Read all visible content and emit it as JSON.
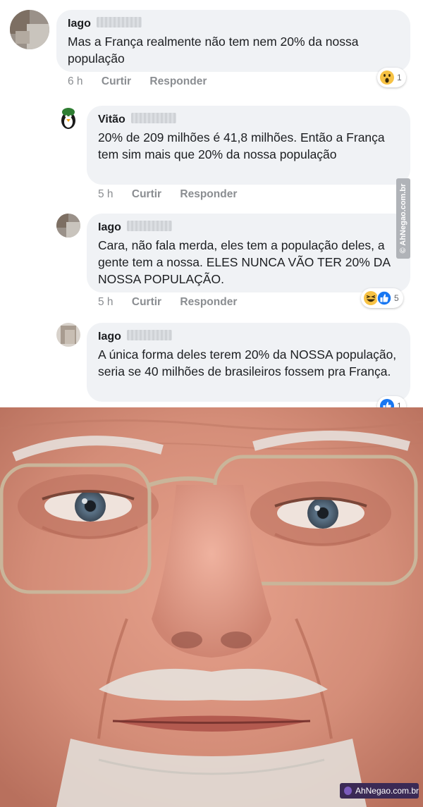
{
  "comments": [
    {
      "author": "Iago",
      "text": "Mas a França realmente não tem nem 20% da nossa população",
      "time": "6 h",
      "like": "Curtir",
      "reply": "Responder",
      "reaction_count": "1",
      "reaction_icons": [
        "wow-icon"
      ]
    },
    {
      "author": "Vitão",
      "text": "20% de 209 milhões é 41,8 milhões. Então a França tem sim mais que 20% da nossa população",
      "time": "5 h",
      "like": "Curtir",
      "reply": "Responder"
    },
    {
      "author": "Iago",
      "text": "Cara, não fala merda, eles tem a população deles, a gente tem a nossa. ELES NUNCA VÃO TER 20% DA NOSSA POPULAÇÃO.",
      "time": "5 h",
      "like": "Curtir",
      "reply": "Responder",
      "reaction_count": "5",
      "reaction_icons": [
        "haha-icon",
        "like-icon"
      ]
    },
    {
      "author": "Iago",
      "text": "A única forma deles terem 20% da NOSSA população, seria se 40 milhões de brasileiros fossem pra França.",
      "reaction_count": "1",
      "reaction_icons": [
        "like-icon"
      ]
    }
  ],
  "watermarks": {
    "side": "© AhNegao.com.br",
    "badge": "AhNegao.com.br"
  },
  "colors": {
    "bubble": "#f0f2f5",
    "meta_text": "#8a8d91",
    "like_blue": "#1877f2",
    "emoji_yellow": "#f7c244"
  }
}
